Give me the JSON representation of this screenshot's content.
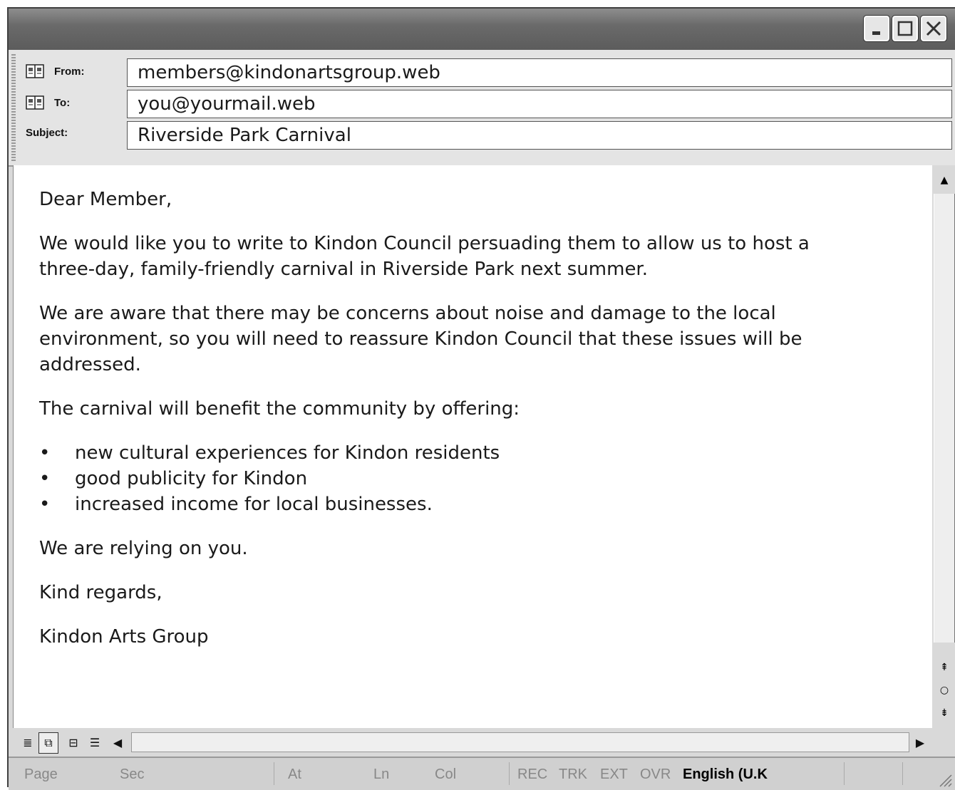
{
  "header": {
    "from_label": "From:",
    "from_value": "members@kindonartsgroup.web",
    "to_label": "To:",
    "to_value": "you@yourmail.web",
    "subject_label": "Subject:",
    "subject_value": "Riverside Park Carnival"
  },
  "message": {
    "greeting": "Dear Member,",
    "para1": "We would like you to write to Kindon Council persuading them to allow us to host a three-day, family-friendly carnival in Riverside Park next summer.",
    "para2": "We are aware that there may be concerns about noise and damage to the local environment, so you will need to reassure Kindon Council that these issues will be addressed.",
    "para3": "The carnival will benefit the community by offering:",
    "bullets": [
      "new cultural experiences for Kindon residents",
      "good publicity for Kindon",
      "increased income for local businesses."
    ],
    "para4": "We are relying on you.",
    "closing": "Kind regards,",
    "signature": "Kindon Arts Group"
  },
  "status_bar": {
    "page": "Page",
    "sec": "Sec",
    "at": "At",
    "ln": "Ln",
    "col": "Col",
    "rec": "REC",
    "trk": "TRK",
    "ext": "EXT",
    "ovr": "OVR",
    "language": "English (U.K"
  }
}
